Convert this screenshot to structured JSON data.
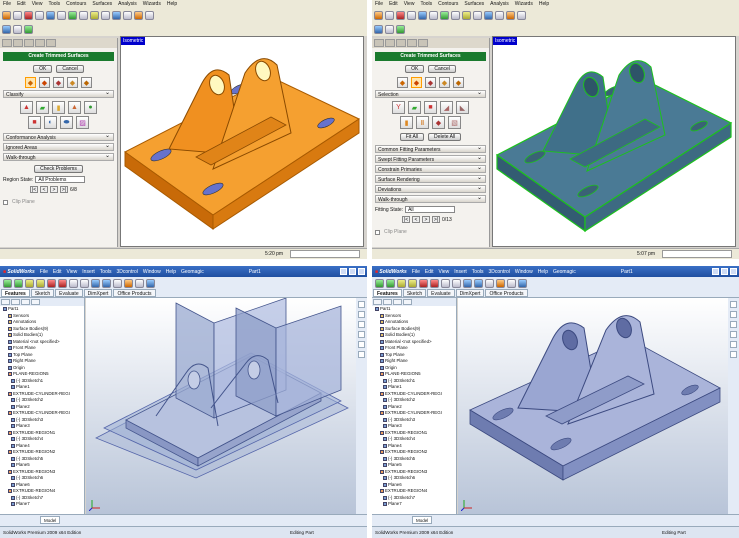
{
  "panels": {
    "top_left": {
      "menu": [
        "File",
        "Edit",
        "View",
        "Tools",
        "Contours",
        "Surfaces",
        "Analysis",
        "Wizards",
        "Help"
      ],
      "viewport_label": "Isometric",
      "dialog": {
        "title": "Create Trimmed Surfaces",
        "ok": "OK",
        "cancel": "Cancel",
        "classify_label": "Classify",
        "sections": [
          "Conformance Analysis",
          "Ignored Areas",
          "Walk-through"
        ],
        "check_problems": "Check Problems",
        "region_state_label": "Region State:",
        "region_state_value": "All Problems",
        "counter": "6/8",
        "clip_plane": "Clip Plane"
      },
      "status_time": "5:20 pm",
      "model_color": "#f08a10"
    },
    "top_right": {
      "menu": [
        "File",
        "Edit",
        "View",
        "Tools",
        "Contours",
        "Surfaces",
        "Analysis",
        "Wizards",
        "Help"
      ],
      "viewport_label": "Isometric",
      "dialog": {
        "title": "Create Trimmed Surfaces",
        "ok": "OK",
        "cancel": "Cancel",
        "selection_label": "Selection",
        "fit_all": "Fit All",
        "delete_all": "Delete All",
        "sections": [
          "Common Fitting Parameters",
          "Swept Fitting Parameters",
          "Constrain Primaries",
          "Surface Rendering",
          "Deviations",
          "Walk-through"
        ],
        "fitting_state_label": "Fitting State:",
        "fitting_state_value": "All",
        "counter": "0/13",
        "clip_plane": "Clip Plane"
      },
      "status_time": "5:07 pm",
      "model_color": "#3f6f88"
    },
    "bottom_left": {
      "app_logo": "SolidWorks",
      "menu": [
        "File",
        "Edit",
        "View",
        "Insert",
        "Tools",
        "3Dcontrol",
        "Window",
        "Help",
        "Geomagic"
      ],
      "part_name": "Part1",
      "tabs": [
        "Features",
        "Sketch",
        "Evaluate",
        "DimXpert",
        "Office Products"
      ],
      "tree": [
        {
          "label": "Part1",
          "level": 0,
          "icon": "part"
        },
        {
          "label": "Sensors",
          "level": 1,
          "icon": "folder"
        },
        {
          "label": "Annotations",
          "level": 1,
          "icon": "folder"
        },
        {
          "label": "Surface Bodies(9)",
          "level": 1,
          "icon": "folder"
        },
        {
          "label": "Solid Bodies(1)",
          "level": 1,
          "icon": "folder"
        },
        {
          "label": "Material <not specified>",
          "level": 1,
          "icon": "material"
        },
        {
          "label": "Front Plane",
          "level": 1,
          "icon": "plane"
        },
        {
          "label": "Top Plane",
          "level": 1,
          "icon": "plane"
        },
        {
          "label": "Right Plane",
          "level": 1,
          "icon": "plane"
        },
        {
          "label": "Origin",
          "level": 1,
          "icon": "plane"
        },
        {
          "label": "PLANE-REGION5",
          "level": 1,
          "icon": "feature"
        },
        {
          "label": "(-) 3DSketch1",
          "level": 2,
          "icon": "sketch"
        },
        {
          "label": "Plane1",
          "level": 2,
          "icon": "plane"
        },
        {
          "label": "EXTRUDE-CYLINDER-REGI",
          "level": 1,
          "icon": "feature"
        },
        {
          "label": "(-) 3DSketch2",
          "level": 2,
          "icon": "sketch"
        },
        {
          "label": "Plane2",
          "level": 2,
          "icon": "plane"
        },
        {
          "label": "EXTRUDE-CYLINDER-REGI",
          "level": 1,
          "icon": "feature"
        },
        {
          "label": "(-) 3DSketch3",
          "level": 2,
          "icon": "sketch"
        },
        {
          "label": "Plane3",
          "level": 2,
          "icon": "plane"
        },
        {
          "label": "EXTRUDE-REGION1",
          "level": 1,
          "icon": "feature"
        },
        {
          "label": "(-) 3DSketch4",
          "level": 2,
          "icon": "sketch"
        },
        {
          "label": "Plane4",
          "level": 2,
          "icon": "plane"
        },
        {
          "label": "EXTRUDE-REGION2",
          "level": 1,
          "icon": "feature"
        },
        {
          "label": "(-) 3DSketch5",
          "level": 2,
          "icon": "sketch"
        },
        {
          "label": "Plane5",
          "level": 2,
          "icon": "plane"
        },
        {
          "label": "EXTRUDE-REGION3",
          "level": 1,
          "icon": "feature"
        },
        {
          "label": "(-) 3DSketch6",
          "level": 2,
          "icon": "sketch"
        },
        {
          "label": "Plane6",
          "level": 2,
          "icon": "plane"
        },
        {
          "label": "EXTRUDE-REGION4",
          "level": 1,
          "icon": "feature"
        },
        {
          "label": "(-) 3DSketch7",
          "level": 2,
          "icon": "sketch"
        },
        {
          "label": "Plane7",
          "level": 2,
          "icon": "plane"
        }
      ],
      "model_tab": "Model",
      "status_left": "SolidWorks Premium 2009 x64 Edition",
      "status_right": "Editing Part"
    },
    "bottom_right": {
      "app_logo": "SolidWorks",
      "menu": [
        "File",
        "Edit",
        "View",
        "Insert",
        "Tools",
        "3Dcontrol",
        "Window",
        "Help",
        "Geomagic"
      ],
      "part_name": "Part1",
      "tabs": [
        "Features",
        "Sketch",
        "Evaluate",
        "DimXpert",
        "Office Products"
      ],
      "tree": [
        {
          "label": "Part1",
          "level": 0,
          "icon": "part"
        },
        {
          "label": "Sensors",
          "level": 1,
          "icon": "folder"
        },
        {
          "label": "Annotations",
          "level": 1,
          "icon": "folder"
        },
        {
          "label": "Surface Bodies(9)",
          "level": 1,
          "icon": "folder"
        },
        {
          "label": "Solid Bodies(1)",
          "level": 1,
          "icon": "folder"
        },
        {
          "label": "Material <not specified>",
          "level": 1,
          "icon": "material"
        },
        {
          "label": "Front Plane",
          "level": 1,
          "icon": "plane"
        },
        {
          "label": "Top Plane",
          "level": 1,
          "icon": "plane"
        },
        {
          "label": "Right Plane",
          "level": 1,
          "icon": "plane"
        },
        {
          "label": "Origin",
          "level": 1,
          "icon": "plane"
        },
        {
          "label": "PLANE-REGION5",
          "level": 1,
          "icon": "feature"
        },
        {
          "label": "(-) 3DSketch1",
          "level": 2,
          "icon": "sketch"
        },
        {
          "label": "Plane1",
          "level": 2,
          "icon": "plane"
        },
        {
          "label": "EXTRUDE-CYLINDER-REGI",
          "level": 1,
          "icon": "feature"
        },
        {
          "label": "(-) 3DSketch2",
          "level": 2,
          "icon": "sketch"
        },
        {
          "label": "Plane2",
          "level": 2,
          "icon": "plane"
        },
        {
          "label": "EXTRUDE-CYLINDER-REGI",
          "level": 1,
          "icon": "feature"
        },
        {
          "label": "(-) 3DSketch3",
          "level": 2,
          "icon": "sketch"
        },
        {
          "label": "Plane3",
          "level": 2,
          "icon": "plane"
        },
        {
          "label": "EXTRUDE-REGION1",
          "level": 1,
          "icon": "feature"
        },
        {
          "label": "(-) 3DSketch4",
          "level": 2,
          "icon": "sketch"
        },
        {
          "label": "Plane4",
          "level": 2,
          "icon": "plane"
        },
        {
          "label": "EXTRUDE-REGION2",
          "level": 1,
          "icon": "feature"
        },
        {
          "label": "(-) 3DSketch5",
          "level": 2,
          "icon": "sketch"
        },
        {
          "label": "Plane5",
          "level": 2,
          "icon": "plane"
        },
        {
          "label": "EXTRUDE-REGION3",
          "level": 1,
          "icon": "feature"
        },
        {
          "label": "(-) 3DSketch6",
          "level": 2,
          "icon": "sketch"
        },
        {
          "label": "Plane6",
          "level": 2,
          "icon": "plane"
        },
        {
          "label": "EXTRUDE-REGION4",
          "level": 1,
          "icon": "feature"
        },
        {
          "label": "(-) 3DSketch7",
          "level": 2,
          "icon": "sketch"
        },
        {
          "label": "Plane7",
          "level": 2,
          "icon": "plane"
        }
      ],
      "model_tab": "Model",
      "status_left": "SolidWorks Premium 2009 x64 Edition",
      "status_right": "Editing Part"
    }
  }
}
